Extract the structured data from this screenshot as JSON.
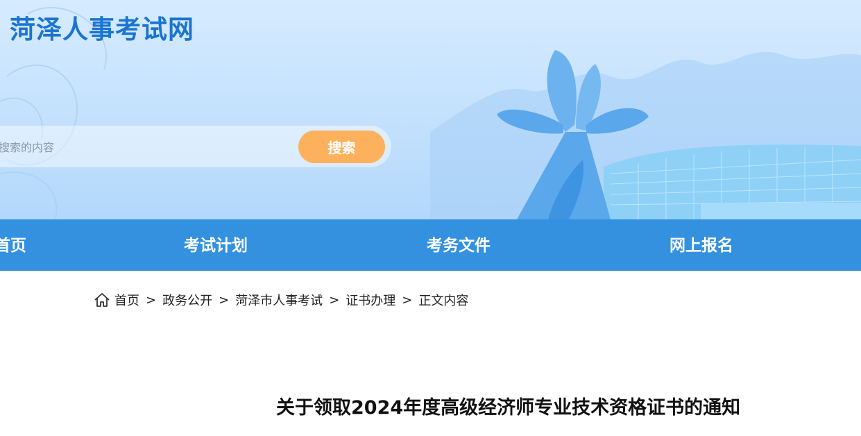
{
  "header": {
    "site_title": "菏泽人事考试网",
    "search": {
      "placeholder": "搜索的内容",
      "button_label": "搜索"
    }
  },
  "nav": {
    "items": [
      {
        "label": "首页"
      },
      {
        "label": "考试计划"
      },
      {
        "label": "考务文件"
      },
      {
        "label": "网上报名"
      }
    ]
  },
  "breadcrumb": {
    "items": [
      "首页",
      "政务公开",
      "菏泽市人事考试",
      "证书办理",
      "正文内容"
    ],
    "separator": ">"
  },
  "article": {
    "title": "关于领取2024年度高级经济师专业技术资格证书的通知"
  },
  "colors": {
    "nav_bg": "#3391df",
    "title_blue": "#1b74d0",
    "search_button": "#fdb15c"
  }
}
